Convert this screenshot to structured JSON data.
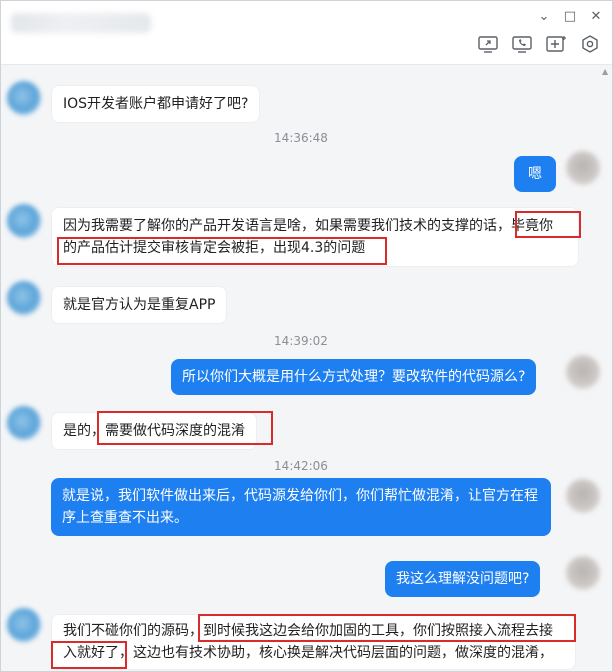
{
  "window": {
    "controls": {
      "minimize": "⌄",
      "maximize": "□",
      "close": "✕"
    },
    "toolbar_icons": [
      "screen-share-icon",
      "phone-icon",
      "add-member-icon",
      "settings-hex-icon"
    ]
  },
  "messages": [
    {
      "side": "in",
      "text": "IOS开发者账户都申请好了吧?"
    },
    {
      "timestamp": "14:36:48"
    },
    {
      "side": "out",
      "text": "嗯"
    },
    {
      "side": "in",
      "line1a": "因为我需要了解你的产品开发语言是啥，如果需要我们技术的支撑的话，",
      "line1b": "毕竟你",
      "line2": "的产品估计提交审核肯定会被拒，出现4.3的问题"
    },
    {
      "side": "in",
      "text": "就是官方认为是重复APP"
    },
    {
      "timestamp": "14:39:02"
    },
    {
      "side": "out",
      "text": "所以你们大概是用什么方式处理？要改软件的代码源么?"
    },
    {
      "side": "in",
      "prefix": "是的，",
      "text": "需要做代码深度的混淆"
    },
    {
      "timestamp": "14:42:06"
    },
    {
      "side": "out",
      "text": "就是说，我们软件做出来后，代码源发给你们，你们帮忙做混淆，让官方在程序上查重查不出来。"
    },
    {
      "side": "out",
      "text": "我这么理解没问题吧?"
    },
    {
      "side": "in",
      "line1a": "我们不碰你们的源码，",
      "line1b": "到时候我这边会给你加固的工具，你们按照接入流程去接",
      "line2a": "入就好了",
      "line2b": "，这边也有技术协助，核心换是解决代码层面的问题，做深度的混淆，"
    }
  ]
}
